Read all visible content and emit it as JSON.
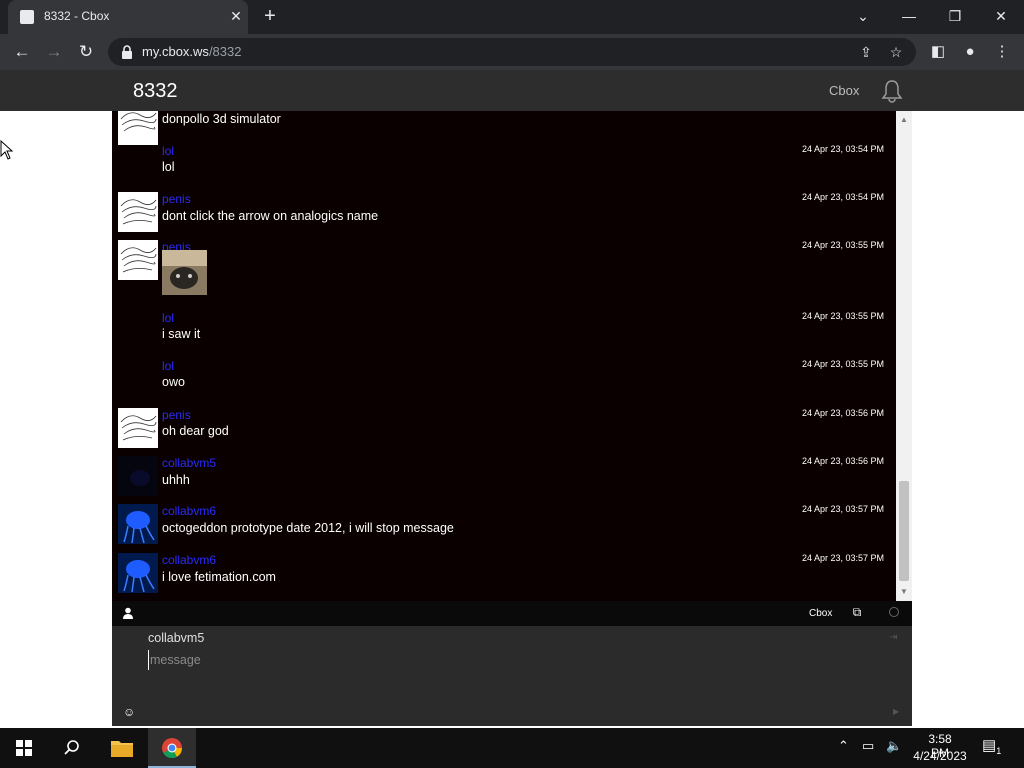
{
  "browser": {
    "tab_title": "8332 - Cbox",
    "tab_close": "✕",
    "new_tab": "+",
    "url_host": "my.cbox.ws",
    "url_path": "/8332"
  },
  "page": {
    "room_title": "8332",
    "brand": "Cbox"
  },
  "messages": [
    {
      "author": "",
      "time": "",
      "text": "donpollo 3d simulator",
      "avatar": "sketch"
    },
    {
      "author": "lol",
      "time": "24 Apr 23, 03:54 PM",
      "text": "lol",
      "avatar": "none"
    },
    {
      "author": "penis",
      "time": "24 Apr 23, 03:54 PM",
      "text": "dont click the arrow on analogics name",
      "avatar": "sketch"
    },
    {
      "author": "penis",
      "time": "24 Apr 23, 03:55 PM",
      "text": "",
      "avatar": "sketch",
      "has_image": true
    },
    {
      "author": "lol",
      "time": "24 Apr 23, 03:55 PM",
      "text": "i saw it",
      "avatar": "none"
    },
    {
      "author": "lol",
      "time": "24 Apr 23, 03:55 PM",
      "text": "owo",
      "avatar": "none"
    },
    {
      "author": "penis",
      "time": "24 Apr 23, 03:56 PM",
      "text": "oh dear god",
      "avatar": "sketch"
    },
    {
      "author": "collabvm5",
      "time": "24 Apr 23, 03:56 PM",
      "text": "uhhh",
      "avatar": "dark"
    },
    {
      "author": "collabvm6",
      "time": "24 Apr 23, 03:57 PM",
      "text": "octogeddon prototype date 2012, i will stop message",
      "avatar": "blue"
    },
    {
      "author": "collabvm6",
      "time": "24 Apr 23, 03:57 PM",
      "text": "i love fetimation.com",
      "avatar": "blue"
    }
  ],
  "chatbar": {
    "cbox_link": "Cbox"
  },
  "form": {
    "name_value": "collabvm5",
    "message_placeholder": "message"
  },
  "taskbar": {
    "time": "3:58 PM",
    "date": "4/24/2023",
    "notification_count": "1"
  },
  "icons": {
    "favicon": "cbox-favicon",
    "lock": "lock-icon",
    "bell": "bell-icon"
  }
}
